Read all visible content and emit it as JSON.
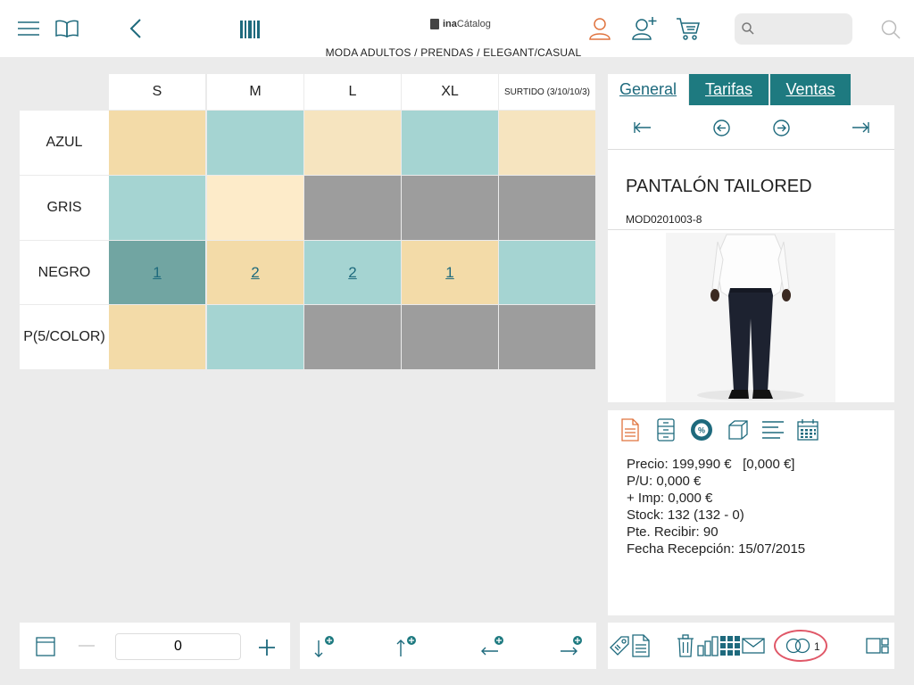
{
  "header": {
    "brand_prefix": "ina",
    "brand_name": "Cátalog",
    "breadcrumb": "MODA ADULTOS / PRENDAS / ELEGANT/CASUAL",
    "search_placeholder": "",
    "icons": [
      "menu-icon",
      "book-icon",
      "back-chevron-icon",
      "barcode-icon",
      "user-icon",
      "add-user-icon",
      "cart-icon",
      "search-icon"
    ]
  },
  "matrix": {
    "columns": [
      "S",
      "M",
      "L",
      "XL",
      "SURTIDO (3/10/10/3)"
    ],
    "rows": [
      {
        "label": "AZUL",
        "cells": [
          "",
          "",
          "",
          "",
          ""
        ],
        "colors": [
          "#f3dba8",
          "#a5d4d2",
          "#f6e4bf",
          "#a5d4d2",
          "#f6e4bf"
        ]
      },
      {
        "label": "GRIS",
        "cells": [
          "",
          "",
          "",
          "",
          ""
        ],
        "colors": [
          "#a5d4d2",
          "#fdebc9",
          "#9d9d9d",
          "#9d9d9d",
          "#9d9d9d"
        ]
      },
      {
        "label": "NEGRO",
        "cells": [
          "1",
          "2",
          "2",
          "1",
          ""
        ],
        "colors": [
          "#71a5a2",
          "#f3dba8",
          "#a5d4d2",
          "#f3dba8",
          "#a5d4d2"
        ]
      },
      {
        "label": "P(5/COLOR)",
        "cells": [
          "",
          "",
          "",
          "",
          ""
        ],
        "colors": [
          "#f3dba8",
          "#a5d4d2",
          "#9d9d9d",
          "#9d9d9d",
          "#9d9d9d"
        ]
      }
    ]
  },
  "tabs": [
    {
      "label": "General",
      "active": true
    },
    {
      "label": "Tarifas",
      "active": false
    },
    {
      "label": "Ventas",
      "active": false
    }
  ],
  "product": {
    "name": "PANTALÓN TAILORED",
    "code": "MOD0201003-8"
  },
  "info": {
    "precio": "Precio: 199,990 €   [0,000 €]",
    "pu": "P/U: 0,000 €",
    "imp": "+ Imp: 0,000 €",
    "stock": "Stock: 132 (132 - 0)",
    "pte": "Pte. Recibir: 90",
    "fecha": "Fecha Recepción: 15/07/2015"
  },
  "bottom": {
    "quantity": "0",
    "compare_count": "1"
  },
  "colors": {
    "accent": "#1e7a80",
    "accent_text": "#1e6a7d",
    "orange": "#e0733e",
    "highlight_ring": "#e05868"
  }
}
